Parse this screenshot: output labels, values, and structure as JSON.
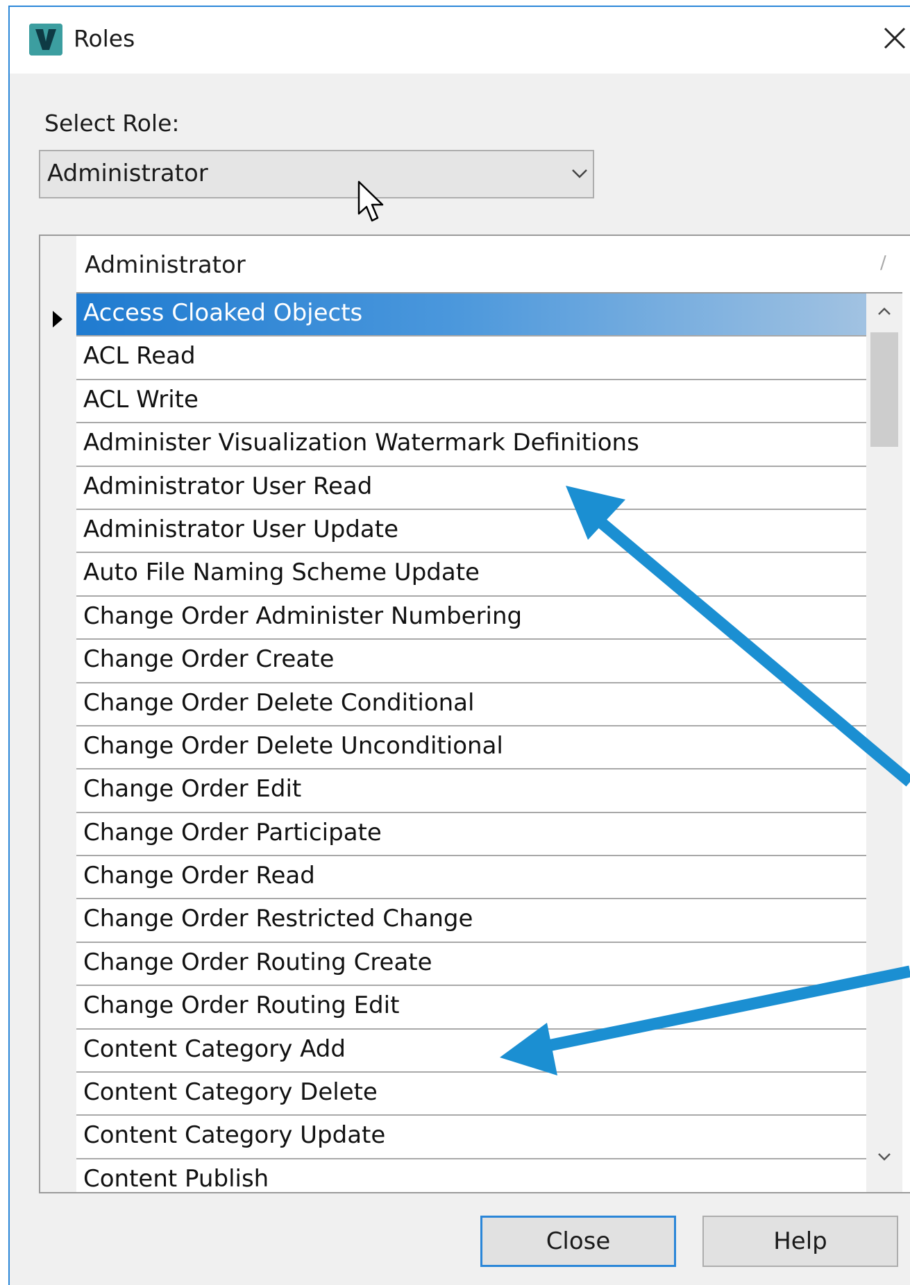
{
  "window": {
    "title": "Roles",
    "app_icon": "vault-v-icon",
    "close_icon": "close-icon"
  },
  "select_role": {
    "label": "Select Role:",
    "value": "Administrator"
  },
  "grid": {
    "column_header": "Administrator",
    "sort_glyph": "/",
    "selected_index": 0,
    "rows": [
      "Access Cloaked Objects",
      "ACL Read",
      "ACL Write",
      "Administer Visualization Watermark Definitions",
      "Administrator User Read",
      "Administrator User Update",
      "Auto File Naming Scheme Update",
      "Change Order Administer Numbering",
      "Change Order Create",
      "Change Order Delete Conditional",
      "Change Order Delete Unconditional",
      "Change Order Edit",
      "Change Order Participate",
      "Change Order Read",
      "Change Order Restricted Change",
      "Change Order Routing Create",
      "Change Order Routing Edit",
      "Content Category Add",
      "Content Category Delete",
      "Content Category Update",
      "Content Publish"
    ]
  },
  "buttons": {
    "close": "Close",
    "help": "Help"
  },
  "colors": {
    "selection": "#1f7bd0",
    "annotation_arrow": "#1b8fd2",
    "window_border": "#2a86d8"
  }
}
